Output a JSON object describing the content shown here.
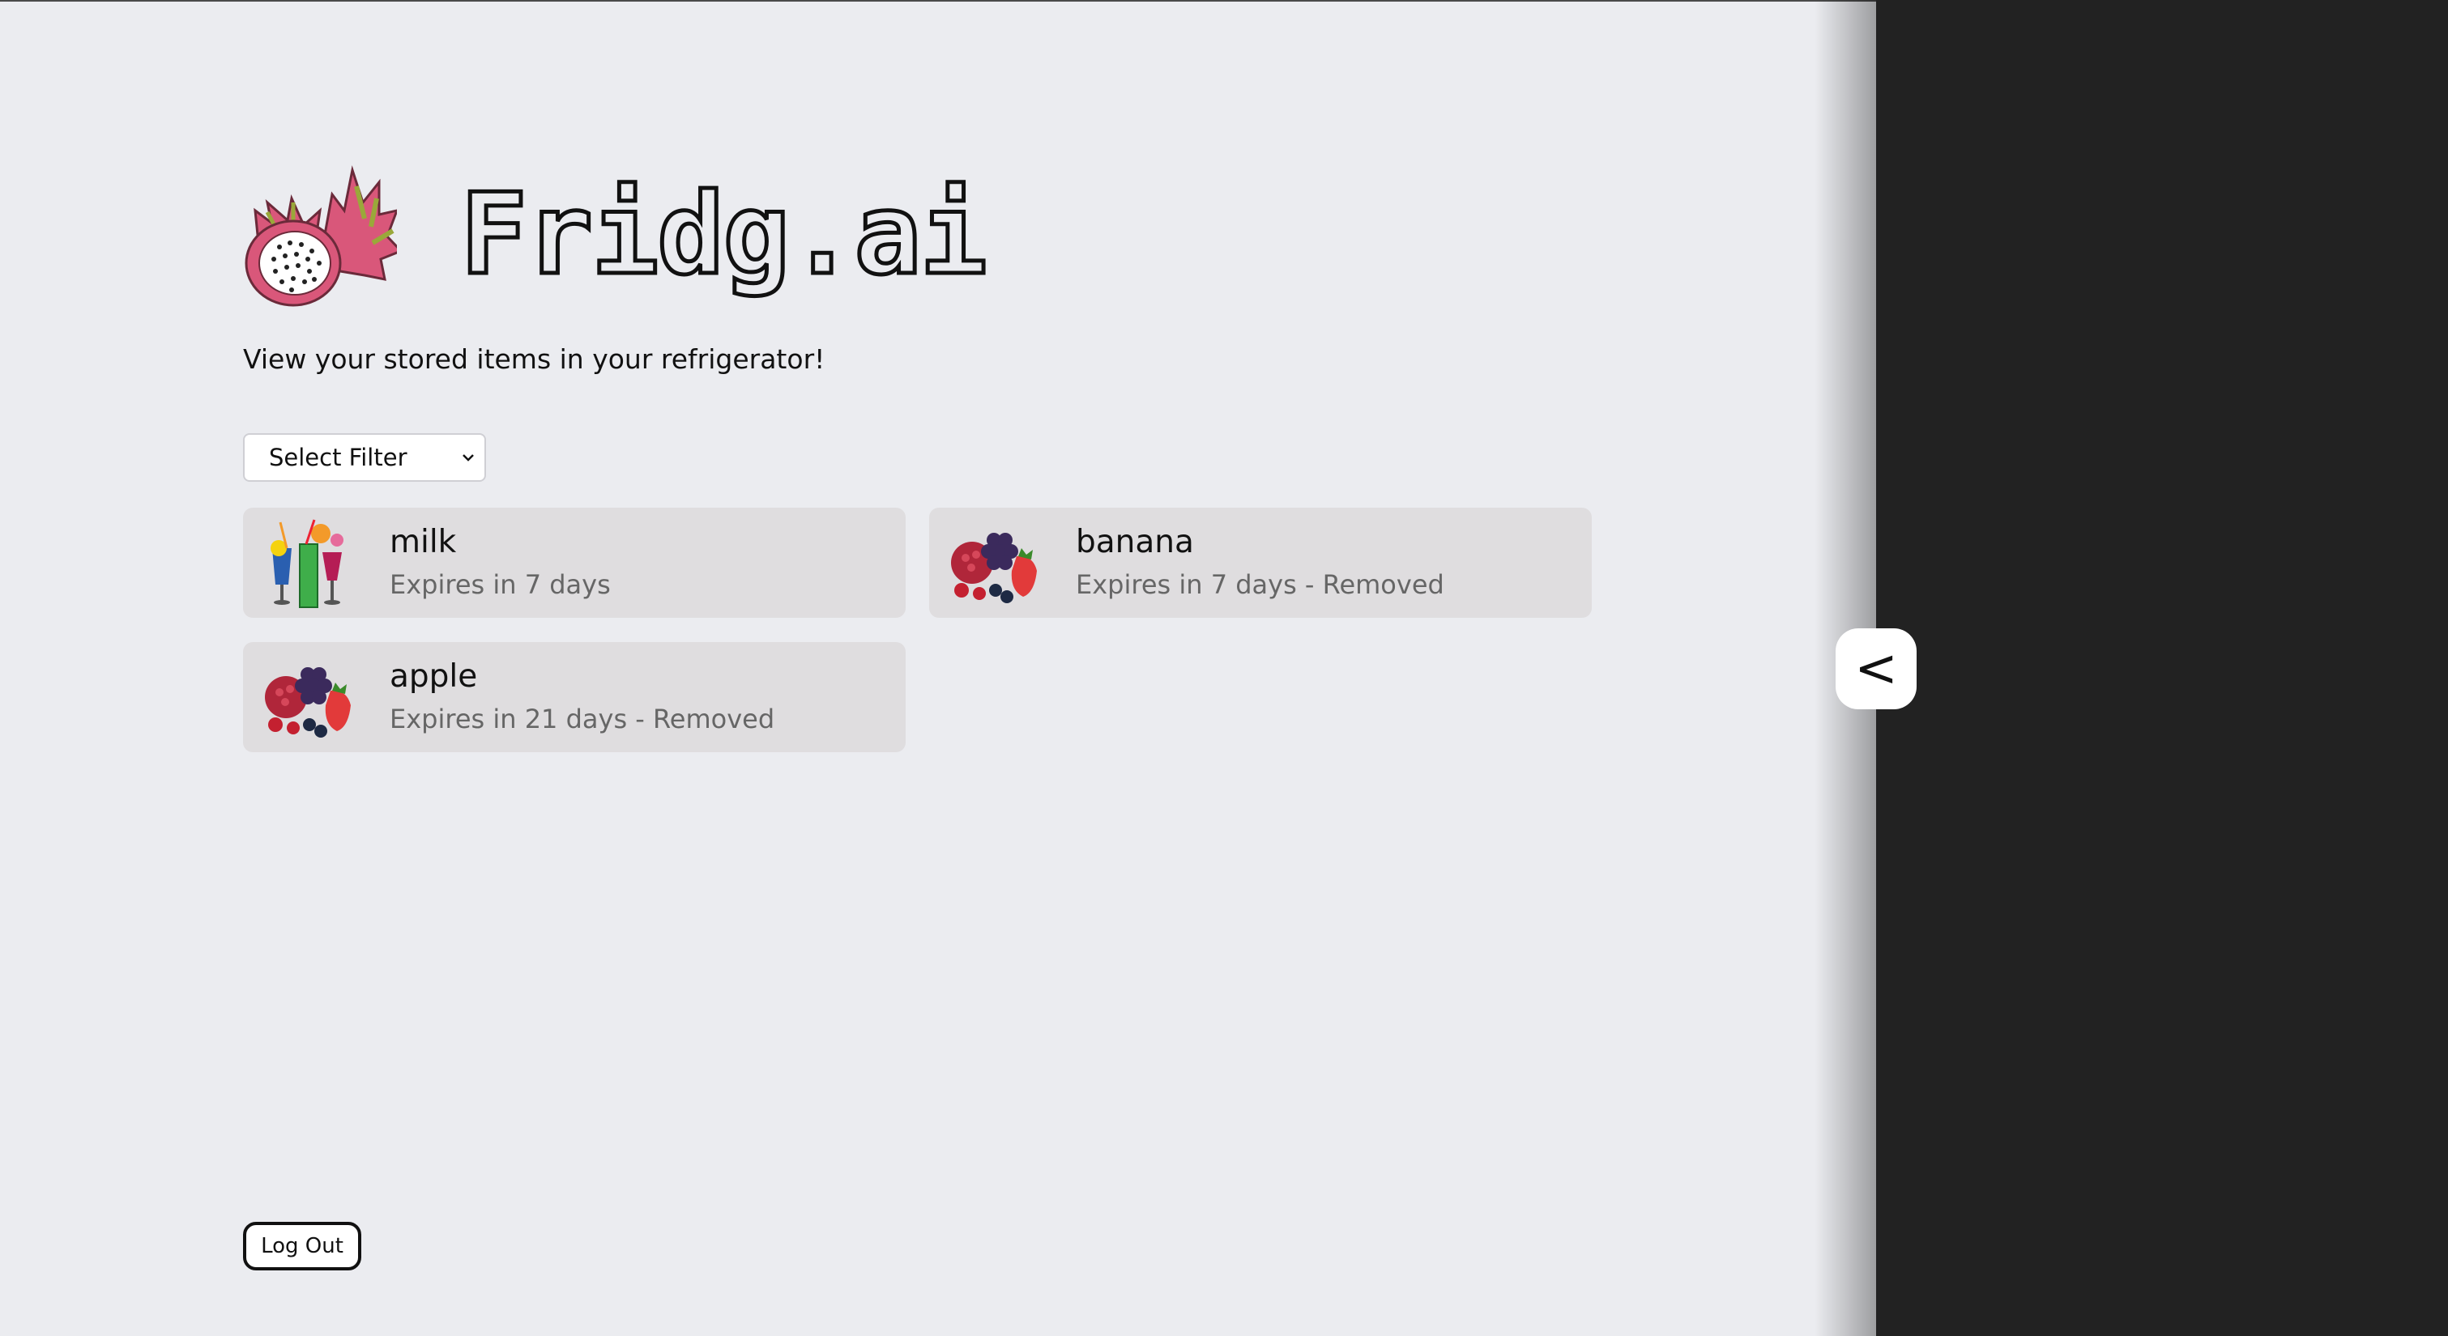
{
  "app": {
    "title": "Fridg.ai",
    "subtitle": "View your stored items in your refrigerator!"
  },
  "filter": {
    "selected_label": "Select Filter"
  },
  "items": [
    {
      "name": "milk",
      "status": "Expires in 7 days",
      "image": "drinks-illustration"
    },
    {
      "name": "banana",
      "status": "Expires in 7 days - Removed",
      "image": "berries-illustration"
    },
    {
      "name": "apple",
      "status": "Expires in 21 days - Removed",
      "image": "berries-illustration"
    }
  ],
  "actions": {
    "logout_label": "Log Out"
  },
  "side_panel": {
    "toggle_label": "<"
  },
  "colors": {
    "background": "#ebecf0",
    "card": "#dfdddf",
    "panel": "#222222",
    "dragonfruit": "#d9577a"
  }
}
